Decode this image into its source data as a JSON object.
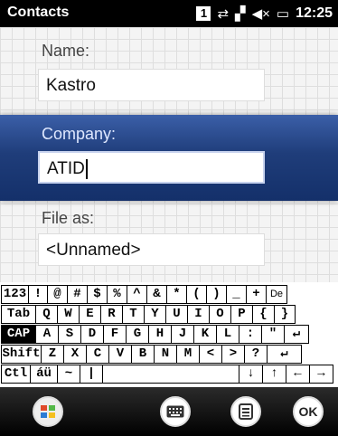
{
  "statusbar": {
    "title": "Contacts",
    "badge": "1",
    "icons": [
      "sync-icon",
      "signal-icon",
      "speaker-muted-icon",
      "battery-icon"
    ],
    "time": "12:25"
  },
  "form": {
    "name_label": "Name:",
    "name_value": "Kastro",
    "company_label": "Company:",
    "company_value": "ATID",
    "fileas_label": "File as:",
    "fileas_value": "<Unnamed>"
  },
  "keyboard": {
    "row1": [
      "123",
      "!",
      "@",
      "#",
      "$",
      "%",
      "^",
      "&",
      "*",
      "(",
      ")",
      "_",
      "+",
      "De"
    ],
    "row2": [
      "Tab",
      "Q",
      "W",
      "E",
      "R",
      "T",
      "Y",
      "U",
      "I",
      "O",
      "P",
      "{",
      "}"
    ],
    "row3": [
      "CAP",
      "A",
      "S",
      "D",
      "F",
      "G",
      "H",
      "J",
      "K",
      "L",
      ":",
      "\"",
      "↵"
    ],
    "row4": [
      "Shift",
      "Z",
      "X",
      "C",
      "V",
      "B",
      "N",
      "M",
      "<",
      ">",
      "?",
      "↵"
    ],
    "row5": [
      "Ctl",
      "áü",
      "~",
      "|",
      "",
      "↓",
      "↑",
      "←",
      "→"
    ]
  },
  "softkeys": {
    "ok_label": "OK"
  }
}
